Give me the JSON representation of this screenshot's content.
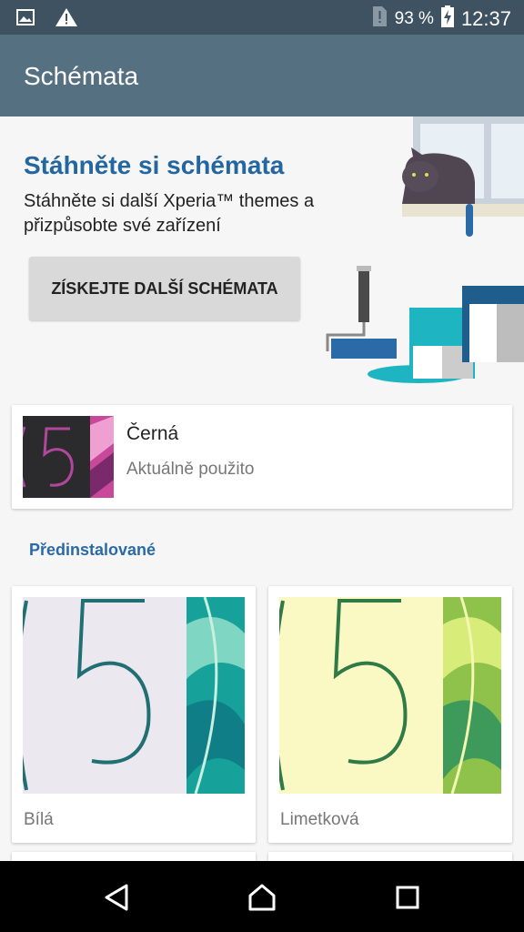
{
  "status_bar": {
    "battery_percent": "93 %",
    "time": "12:37",
    "icons": [
      "image-notification-icon",
      "warning-icon",
      "no-sim-icon",
      "battery-charging-icon"
    ]
  },
  "app_bar": {
    "title": "Schémata"
  },
  "promo": {
    "title": "Stáhněte si schémata",
    "text": "Stáhněte si další Xperia™ themes a přizpůsobte své zařízení",
    "button_label": "ZÍSKEJTE DALŠÍ SCHÉMATA"
  },
  "current_theme": {
    "name": "Černá",
    "status": "Aktuálně použito"
  },
  "section": {
    "label": "Předinstalované"
  },
  "themes": [
    {
      "name": "Bílá"
    },
    {
      "name": "Limetková"
    }
  ],
  "colors": {
    "status_bar": "#3e5262",
    "app_bar": "#557080",
    "accent": "#2366a0",
    "button": "#d9d9d9"
  }
}
